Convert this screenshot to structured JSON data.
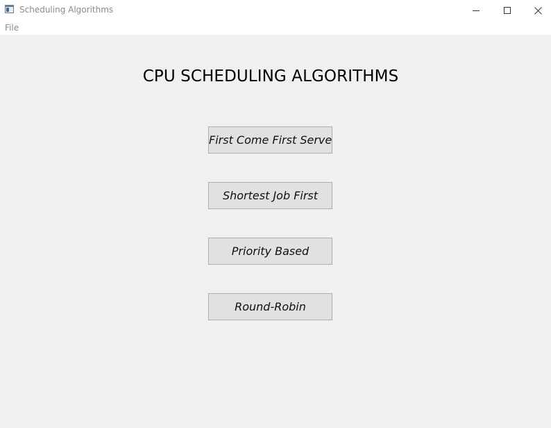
{
  "window": {
    "title": "Scheduling Algorithms",
    "icon": "app-window-icon",
    "controls": [
      "minimize-icon",
      "maximize-icon",
      "close-icon"
    ]
  },
  "menubar": {
    "items": [
      {
        "label": "File"
      }
    ]
  },
  "main": {
    "heading": "CPU SCHEDULING ALGORITHMS",
    "buttons": [
      {
        "label": "First Come First Serve"
      },
      {
        "label": "Shortest Job First"
      },
      {
        "label": "Priority Based"
      },
      {
        "label": "Round-Robin"
      }
    ]
  },
  "colors": {
    "window_background": "#f0f0f0",
    "titlebar_background": "#ffffff",
    "button_face": "#e1e1e1",
    "button_border": "#adadad"
  }
}
